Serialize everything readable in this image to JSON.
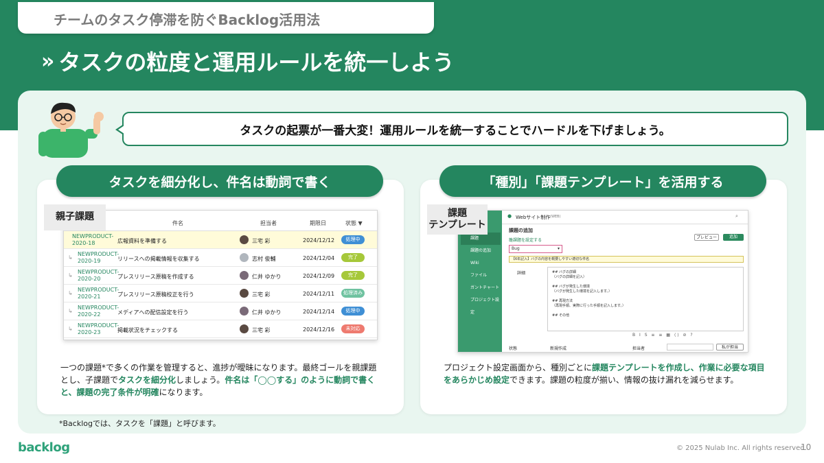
{
  "kicker": "チームのタスク停滞を防ぐBacklog活用法",
  "title": "タスクの粒度と運用ルールを統一しよう",
  "title_chevron": "»",
  "speech": "タスクの起票が一番大変！運用ルールを統一することでハードルを下げましょう。",
  "left": {
    "pill": "タスクを細分化し、件名は動詞で書く",
    "tag": "親子課題",
    "columns": {
      "subject": "件名",
      "assignee": "担当者",
      "due": "期限日",
      "status": "状態 ▼"
    },
    "rows": [
      {
        "key": "NEWPRODUCT-2020-18",
        "subject": "広報資料を準備する",
        "assignee": "三宅 彩",
        "due": "2024/12/12",
        "status": "処理中",
        "status_color": "#3f8fd5"
      },
      {
        "key": "NEWPRODUCT-2020-19",
        "subject": "リリースへの掲載情報を収集する",
        "assignee": "志村 俊輔",
        "due": "2024/12/04",
        "status": "完了",
        "status_color": "#a6c83a"
      },
      {
        "key": "NEWPRODUCT-2020-20",
        "subject": "プレスリリース原稿を作成する",
        "assignee": "仁井 ゆかり",
        "due": "2024/12/09",
        "status": "完了",
        "status_color": "#a6c83a"
      },
      {
        "key": "NEWPRODUCT-2020-21",
        "subject": "プレスリリース原稿校正を行う",
        "assignee": "三宅 彩",
        "due": "2024/12/11",
        "status": "処理済み",
        "status_color": "#6fc2a0"
      },
      {
        "key": "NEWPRODUCT-2020-22",
        "subject": "メディアへの配信設定を行う",
        "assignee": "仁井 ゆかり",
        "due": "2024/12/14",
        "status": "処理中",
        "status_color": "#3f8fd5"
      },
      {
        "key": "NEWPRODUCT-2020-23",
        "subject": "掲載状況をチェックする",
        "assignee": "三宅 彩",
        "due": "2024/12/16",
        "status": "未対応",
        "status_color": "#ee7a6f"
      }
    ],
    "desc_1": "一つの課題*で多くの作業を管理すると、進捗が曖昧になります。最終ゴールを親課題とし、子課題で",
    "desc_hl_1": "タスクを細分化",
    "desc_2": "しましょう。",
    "desc_hl_2": "件名は「◯◯する」のように動詞で書くと、課題の完了条件が明確",
    "desc_3": "になります。"
  },
  "right": {
    "pill": "「種別」「課題テンプレート」を活用する",
    "tag_line1": "課題",
    "tag_line2": "テンプレート",
    "project": "Webサイト制作",
    "project_key": "(WEB)",
    "page_heading": "課題の追加",
    "template_link": "雛課題を設定する",
    "preview_btn": "プレビュー",
    "add_btn": "追加",
    "type_value": "Bug",
    "summary_placeholder": "【6年記入】バグの内容を概要しやすい適切な件名",
    "detail_label": "詳細",
    "template_body": [
      "## バグの詳細",
      "（バグの詳細を記入）",
      "",
      "## バグが発生した環境",
      "（バグが発生した環境を記入します。）",
      "",
      "## 再現方法",
      "（再現手順、実際に行った手順を記入します。）",
      "",
      "## その他"
    ],
    "status_label": "状態",
    "status_value": "新規作成",
    "assignee_label": "担当者",
    "me_btn": "私が担当",
    "side_items": [
      "課題",
      "課題の追加",
      "Wiki",
      "ファイル",
      "ガントチャート",
      "プロジェクト設定"
    ],
    "desc_1": "プロジェクト設定画面から、種別ごとに",
    "desc_hl_1": "課題テンプレートを作成し、作業に必要な項目をあらかじめ設定",
    "desc_2": "できます。課題の粒度が揃い、情報の抜け漏れを減らせます。"
  },
  "footnote": "*Backlogでは、タスクを「課題」と呼びます。",
  "logo": "backlog",
  "copyright": "© 2025 Nulab Inc. All rights reserved.",
  "page_number": "10",
  "colors": {
    "brand_green": "#24865f",
    "panel": "#e9f6f0"
  }
}
